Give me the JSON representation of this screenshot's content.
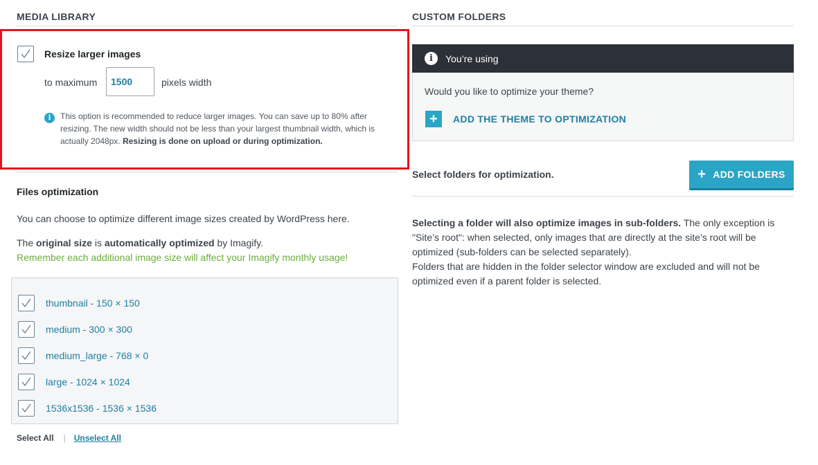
{
  "media_library": {
    "title": "MEDIA LIBRARY",
    "resize": {
      "label": "Resize larger images",
      "checked": true,
      "prefix": "to maximum",
      "value": "1500",
      "suffix": "pixels width",
      "help_text": "This option is recommended to reduce larger images. You can save up to 80% after resizing. The new width should not be less than your largest thumbnail width, which is actually 2048px.",
      "help_bold": "Resizing is done on upload or during optimization."
    }
  },
  "files_optimization": {
    "title": "Files optimization",
    "intro": "You can choose to optimize different image sizes created by WordPress here.",
    "original_prefix": "The",
    "original_bold1": "original size",
    "original_mid": "is",
    "original_bold2": "automatically optimized",
    "original_suffix": "by Imagify.",
    "warning": "Remember each additional image size will affect your Imagify monthly usage!",
    "sizes": [
      {
        "label": "thumbnail - 150 × 150",
        "checked": true
      },
      {
        "label": "medium - 300 × 300",
        "checked": true
      },
      {
        "label": "medium_large - 768 × 0",
        "checked": true
      },
      {
        "label": "large - 1024 × 1024",
        "checked": true
      },
      {
        "label": "1536x1536 - 1536 × 1536",
        "checked": true
      }
    ],
    "select_all": "Select All",
    "separator": "|",
    "unselect_all": "Unselect All"
  },
  "custom_folders": {
    "title": "CUSTOM FOLDERS",
    "notice": "You’re using",
    "question": "Would you like to optimize your theme?",
    "add_theme": "ADD THE THEME TO OPTIMIZATION",
    "select_label": "Select folders for optimization.",
    "add_folders": "ADD FOLDERS",
    "desc_bold": "Selecting a folder will also optimize images in sub-folders.",
    "desc_rest": "The only exception is \"Site’s root\": when selected, only images that are directly at the site’s root will be optimized (sub-folders can be selected separately).",
    "desc2": "Folders that are hidden in the folder selector window are excluded and will not be optimized even if a parent folder is selected."
  },
  "colors": {
    "accent": "#2aa5c6",
    "link": "#1e7fa3",
    "highlight": "#e3141f",
    "green": "#6aad3a",
    "dark_bar": "#2c3038"
  },
  "icons": {
    "checkbox": "check-icon",
    "info": "info-icon",
    "plus": "plus-icon"
  }
}
